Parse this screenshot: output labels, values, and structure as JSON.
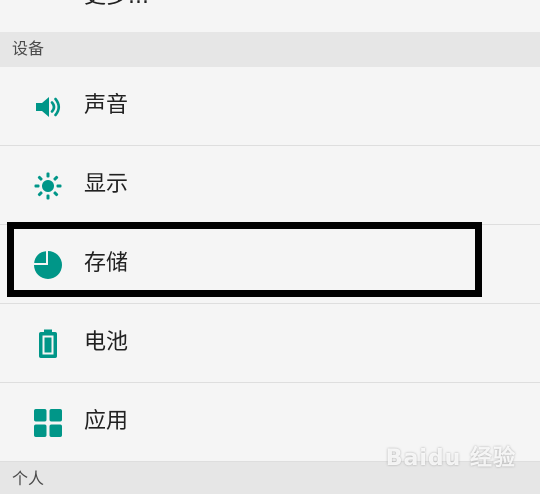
{
  "colors": {
    "accent": "#009688",
    "background": "#f5f5f5",
    "section_header_bg": "#e6e6e6",
    "divider": "#dedede",
    "text_primary": "#212121",
    "text_secondary": "#4a4a4a",
    "highlight_border": "#000000"
  },
  "top_partial": {
    "label": "更多..."
  },
  "sections": {
    "device": {
      "header": "设备",
      "items": [
        {
          "label": "声音",
          "icon": "speaker-icon"
        },
        {
          "label": "显示",
          "icon": "brightness-icon"
        },
        {
          "label": "存储",
          "icon": "pie-chart-icon"
        },
        {
          "label": "电池",
          "icon": "battery-icon"
        },
        {
          "label": "应用",
          "icon": "apps-grid-icon"
        }
      ]
    },
    "personal": {
      "header": "个人"
    }
  },
  "watermark": {
    "text": "Baidu 经验"
  }
}
